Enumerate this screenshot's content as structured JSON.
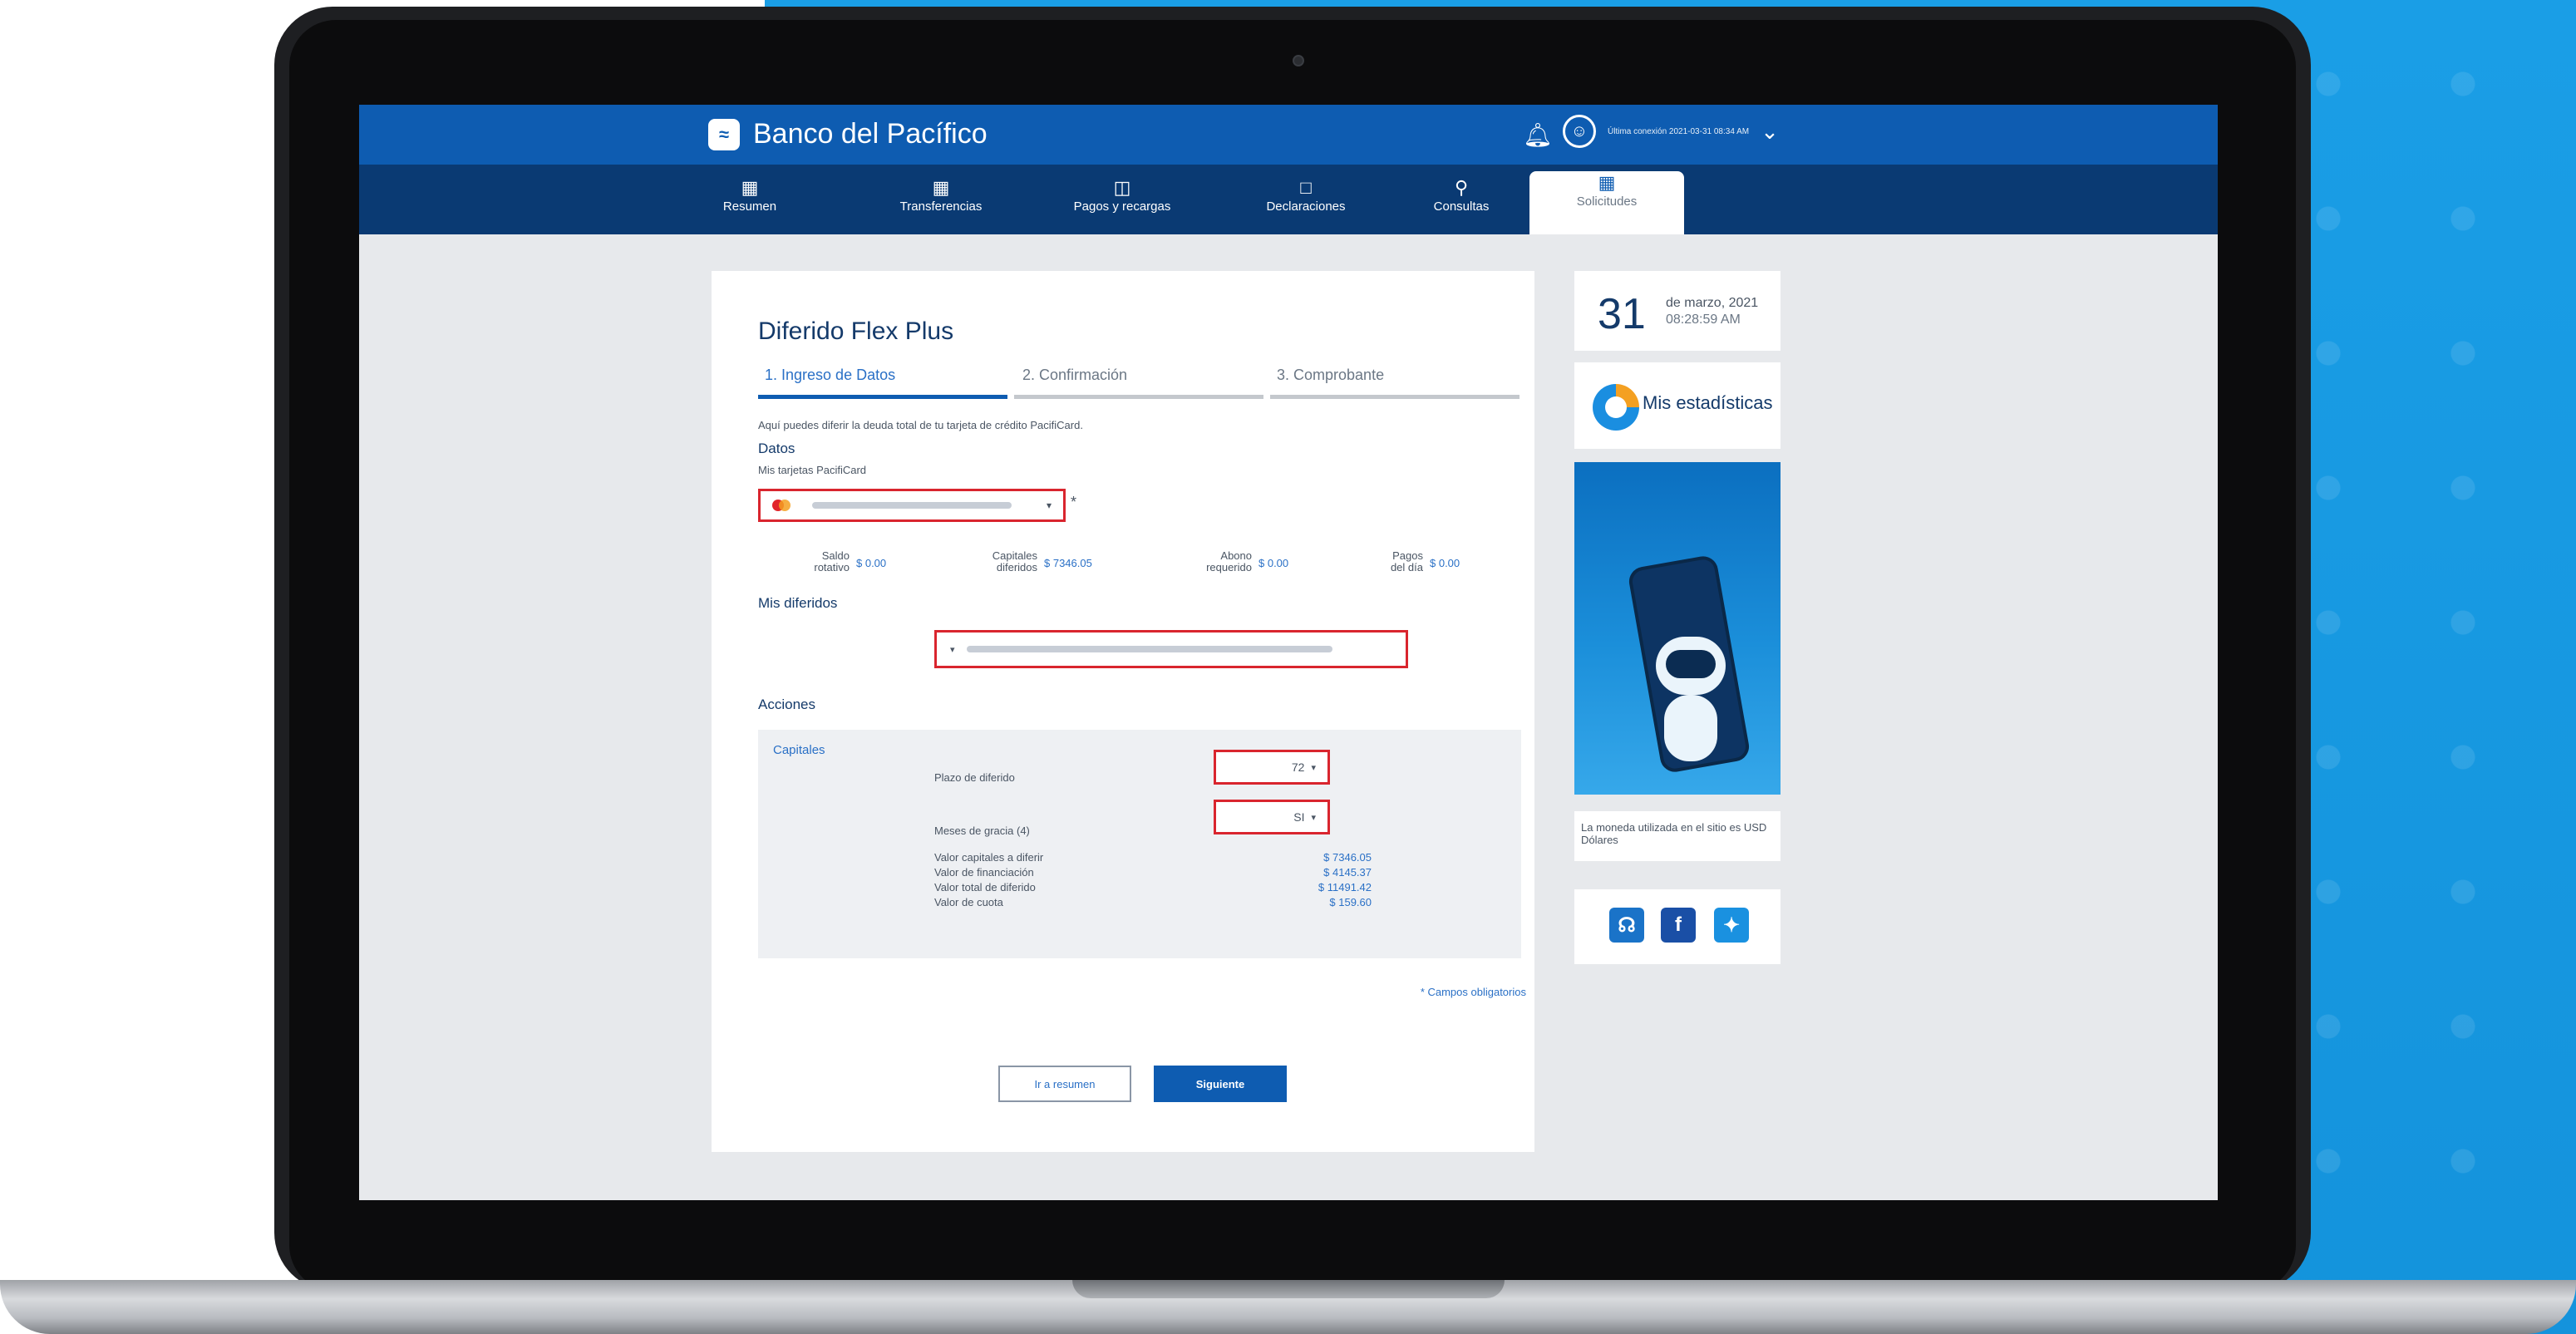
{
  "app": {
    "brand": "Banco del Pacífico",
    "last_login": "Última conexión 2021-03-31 08:34 AM"
  },
  "nav": [
    {
      "label": "Resumen"
    },
    {
      "label": "Transferencias"
    },
    {
      "label": "Pagos y recargas"
    },
    {
      "label": "Declaraciones"
    },
    {
      "label": "Consultas"
    },
    {
      "label": "Solicitudes",
      "active": true
    }
  ],
  "form": {
    "title": "Diferido Flex Plus",
    "steps": [
      {
        "label": "1. Ingreso de Datos",
        "state": "active"
      },
      {
        "label": "2. Confirmación",
        "state": "pending"
      },
      {
        "label": "3. Comprobante",
        "state": "pending"
      }
    ],
    "intro": "Aquí puedes diferir la deuda total de tu tarjeta de crédito PacifiCard.",
    "datos_label": "Datos",
    "tarjetas_label": "Mis tarjetas PacifiCard",
    "required_mark": "*",
    "summary": [
      {
        "label_1": "Saldo",
        "label_2": "rotativo",
        "value": "$ 0.00"
      },
      {
        "label_1": "Capitales",
        "label_2": "diferidos",
        "value": "$ 7346.05"
      },
      {
        "label_1": "Abono",
        "label_2": "requerido",
        "value": "$ 0.00"
      },
      {
        "label_1": "Pagos",
        "label_2": "del día",
        "value": "$ 0.00"
      }
    ],
    "mis_diferidos_label": "Mis diferidos",
    "acciones_label": "Acciones",
    "capitales_label": "Capitales",
    "plazo_label": "Plazo de diferido",
    "plazo_value": "72",
    "meses_gracia_label": "Meses de gracia (4)",
    "meses_gracia_value": "SI",
    "details": [
      {
        "label": "Valor capitales a diferir",
        "value": "$ 7346.05"
      },
      {
        "label": "Valor de financiación",
        "value": "$ 4145.37"
      },
      {
        "label": "Valor total de diferido",
        "value": "$ 11491.42"
      },
      {
        "label": "Valor de cuota",
        "value": "$ 159.60"
      }
    ],
    "required_note": "* Campos obligatorios",
    "back_button": "Ir a resumen",
    "next_button": "Siguiente"
  },
  "sidebar": {
    "day": "31",
    "month_year": "de marzo, 2021",
    "time": "08:28:59 AM",
    "stats_label": "Mis estadísticas",
    "currency_note": "La moneda utilizada en el sitio es USD Dólares"
  },
  "icons": {
    "bell": "bell-icon",
    "user": "user-icon",
    "chevron": "chevron-down-icon",
    "support": "headset-icon",
    "facebook": "facebook-icon",
    "twitter": "twitter-icon"
  },
  "colors": {
    "primary": "#0e5cb1",
    "nav_dark": "#0a3a73",
    "highlight_border": "#d9252e",
    "link_blue": "#2a70c6",
    "background_blue": "#1a9ee6"
  }
}
